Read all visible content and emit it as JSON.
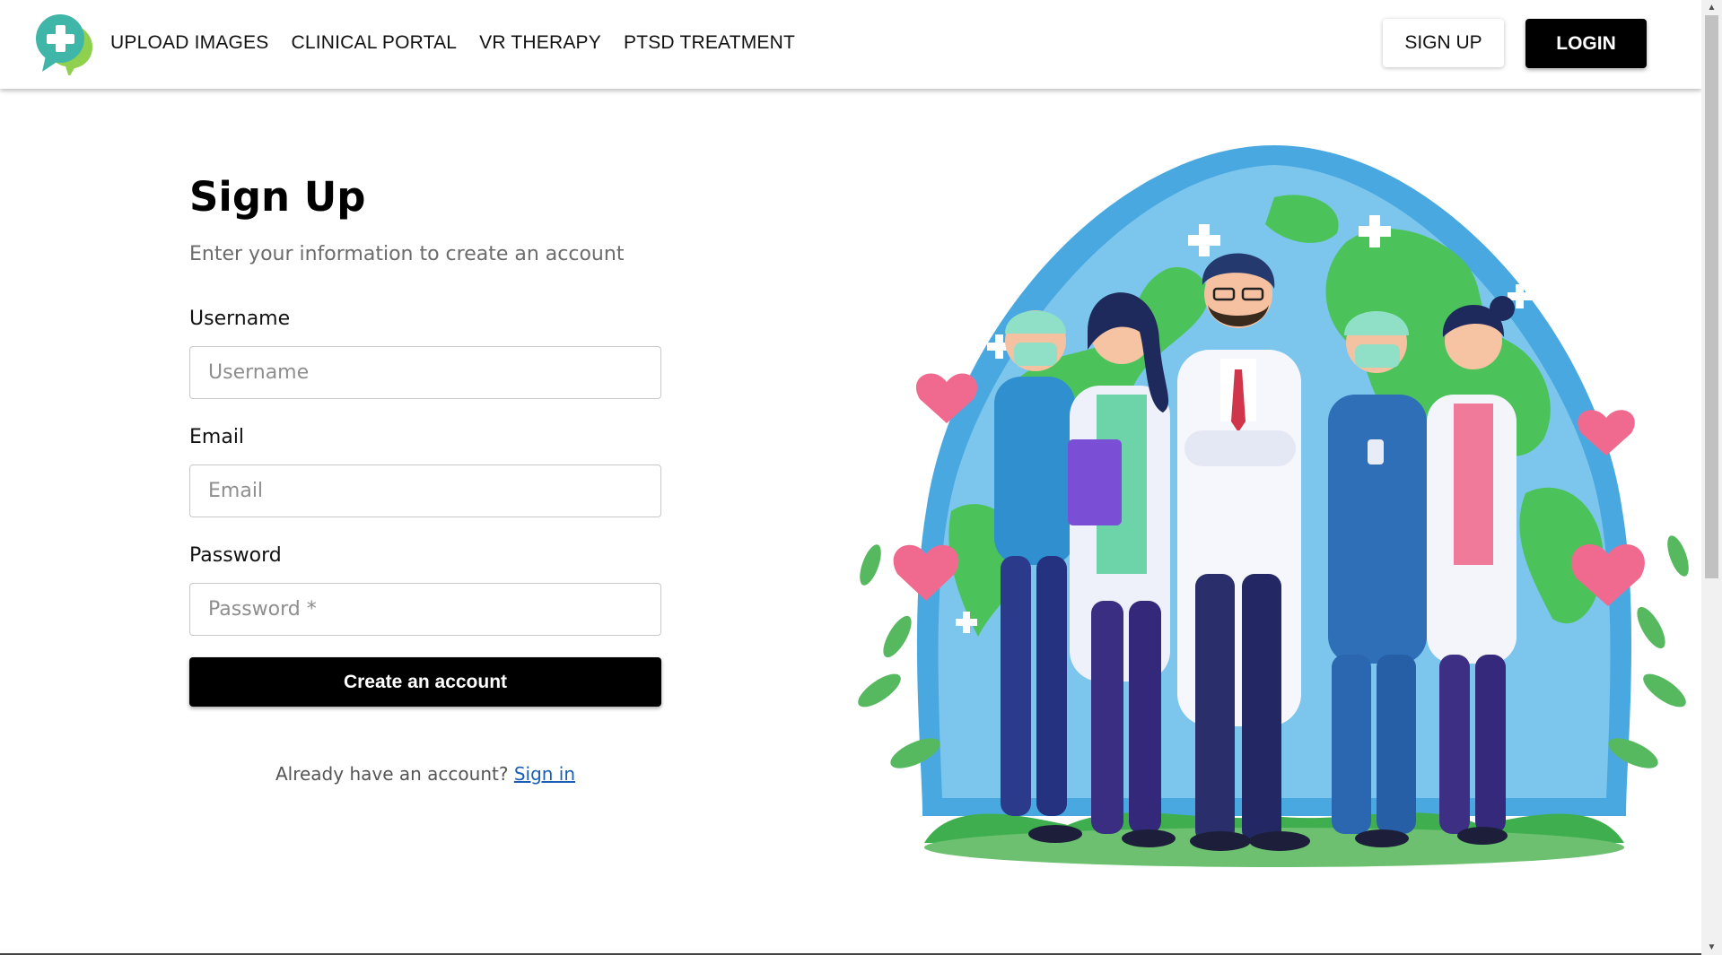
{
  "nav": {
    "links": [
      "UPLOAD IMAGES",
      "CLINICAL PORTAL",
      "VR THERAPY",
      "PTSD TREATMENT"
    ],
    "signup_label": "SIGN UP",
    "login_label": "LOGIN"
  },
  "form": {
    "title": "Sign Up",
    "subtitle": "Enter your information to create an account",
    "username_label": "Username",
    "username_placeholder": "Username",
    "email_label": "Email",
    "email_placeholder": "Email",
    "password_label": "Password",
    "password_placeholder": "Password *",
    "submit_label": "Create an account",
    "signin_prompt": "Already have an account?",
    "signin_link": "Sign in"
  },
  "icons": {
    "logo": "medical-cross-chat-icon",
    "scroll_up": "scroll-up-arrow-icon",
    "scroll_down": "scroll-down-arrow-icon"
  },
  "colors": {
    "primary_button": "#000000",
    "link": "#1a5fb4",
    "logo_teal": "#3fb6a8",
    "logo_green": "#8fd14f",
    "globe_blue": "#4aa8e0",
    "globe_green": "#4cc35a"
  }
}
